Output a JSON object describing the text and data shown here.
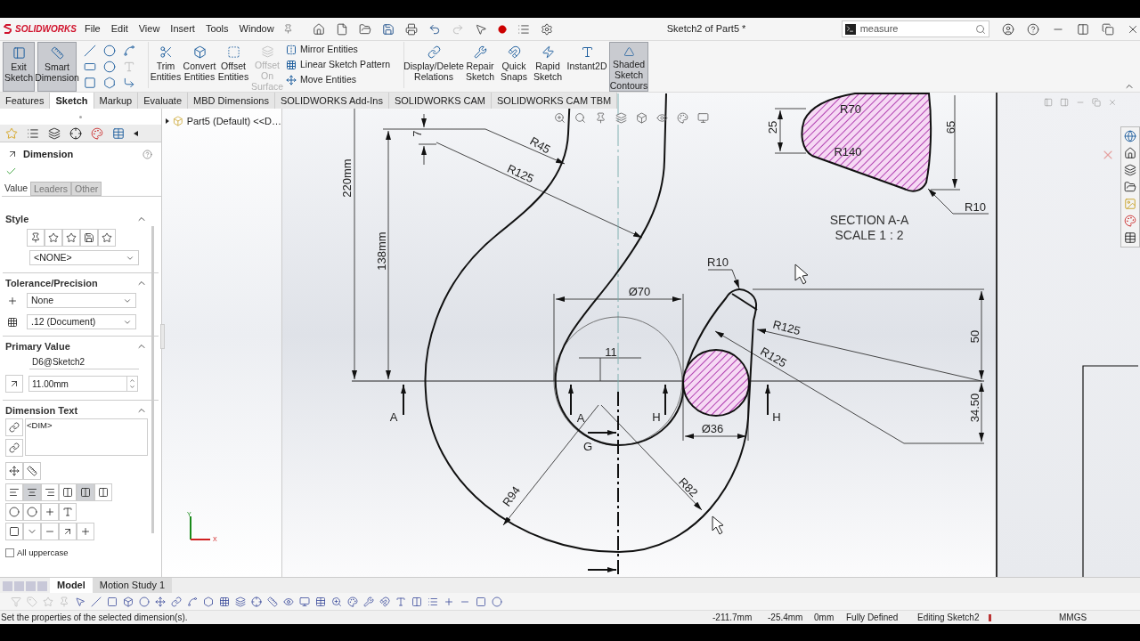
{
  "title_bar": {
    "logo": "SOLIDWORKS",
    "menus": [
      "File",
      "Edit",
      "View",
      "Insert",
      "Tools",
      "Window"
    ],
    "document_title": "Sketch2 of Part5 *",
    "search": {
      "value": "measure"
    }
  },
  "ribbon": {
    "tools": [
      {
        "label": "Exit Sketch",
        "selected": true,
        "disabled": false
      },
      {
        "label": "Smart Dimension",
        "selected": true,
        "disabled": false
      },
      {
        "label": "Trim Entities",
        "selected": false,
        "disabled": false
      },
      {
        "label": "Convert Entities",
        "selected": false,
        "disabled": false
      },
      {
        "label": "Offset Entities",
        "selected": false,
        "disabled": false
      },
      {
        "label": "Offset On Surface",
        "selected": false,
        "disabled": true
      }
    ],
    "entity_tools": [
      "Mirror Entities",
      "Linear Sketch Pattern",
      "Move Entities"
    ],
    "more_tools": [
      {
        "label": "Display/Delete Relations",
        "selected": false
      },
      {
        "label": "Repair Sketch",
        "selected": false
      },
      {
        "label": "Quick Snaps",
        "selected": false
      },
      {
        "label": "Rapid Sketch",
        "selected": false
      },
      {
        "label": "Instant2D",
        "selected": false
      },
      {
        "label": "Shaded Sketch Contours",
        "selected": true
      }
    ]
  },
  "command_tabs": [
    {
      "label": "Features",
      "selected": false
    },
    {
      "label": "Sketch",
      "selected": true
    },
    {
      "label": "Markup",
      "selected": false
    },
    {
      "label": "Evaluate",
      "selected": false
    },
    {
      "label": "MBD Dimensions",
      "selected": false
    },
    {
      "label": "SOLIDWORKS Add-Ins",
      "selected": false
    },
    {
      "label": "SOLIDWORKS CAM",
      "selected": false
    },
    {
      "label": "SOLIDWORKS CAM TBM",
      "selected": false
    }
  ],
  "property_manager": {
    "title": "Dimension",
    "tabs": [
      {
        "label": "Value",
        "selected": true
      },
      {
        "label": "Leaders",
        "selected": false
      },
      {
        "label": "Other",
        "selected": false
      }
    ],
    "style": {
      "heading": "Style",
      "value": "<NONE>"
    },
    "tolerance": {
      "heading": "Tolerance/Precision",
      "type": "None",
      "precision": ".12 (Document)"
    },
    "primary_value": {
      "heading": "Primary Value",
      "name": "D6@Sketch2",
      "value": "11.00mm"
    },
    "dimension_text": {
      "heading": "Dimension Text",
      "value": "<DIM>"
    },
    "all_uppercase": {
      "label": "All uppercase",
      "checked": false
    }
  },
  "feature_tree": {
    "root": "Part5 (Default) <<D…",
    "triad": {
      "x": "X",
      "y": "Y"
    }
  },
  "drawing": {
    "labels": [
      "220mm",
      "138mm",
      "7",
      "R45",
      "R125",
      "Ø70",
      "11",
      "A",
      "A",
      "H",
      "G",
      "R94",
      "R82",
      "Ø36",
      "R10",
      "R125",
      "R125",
      "H",
      "50",
      "34.50",
      "R70",
      "R140",
      "25",
      "65",
      "R10"
    ],
    "section_title": "SECTION A-A",
    "section_scale": "SCALE 1 : 2"
  },
  "bottom_tabs": [
    {
      "label": "Model",
      "selected": true
    },
    {
      "label": "Motion Study 1",
      "selected": false
    }
  ],
  "status_bar": {
    "message": "Set the properties of the selected dimension(s).",
    "x": "-211.7mm",
    "y": "-25.4mm",
    "z": "0mm",
    "state": "Fully Defined",
    "mode": "Editing Sketch2",
    "units": "MMGS"
  }
}
